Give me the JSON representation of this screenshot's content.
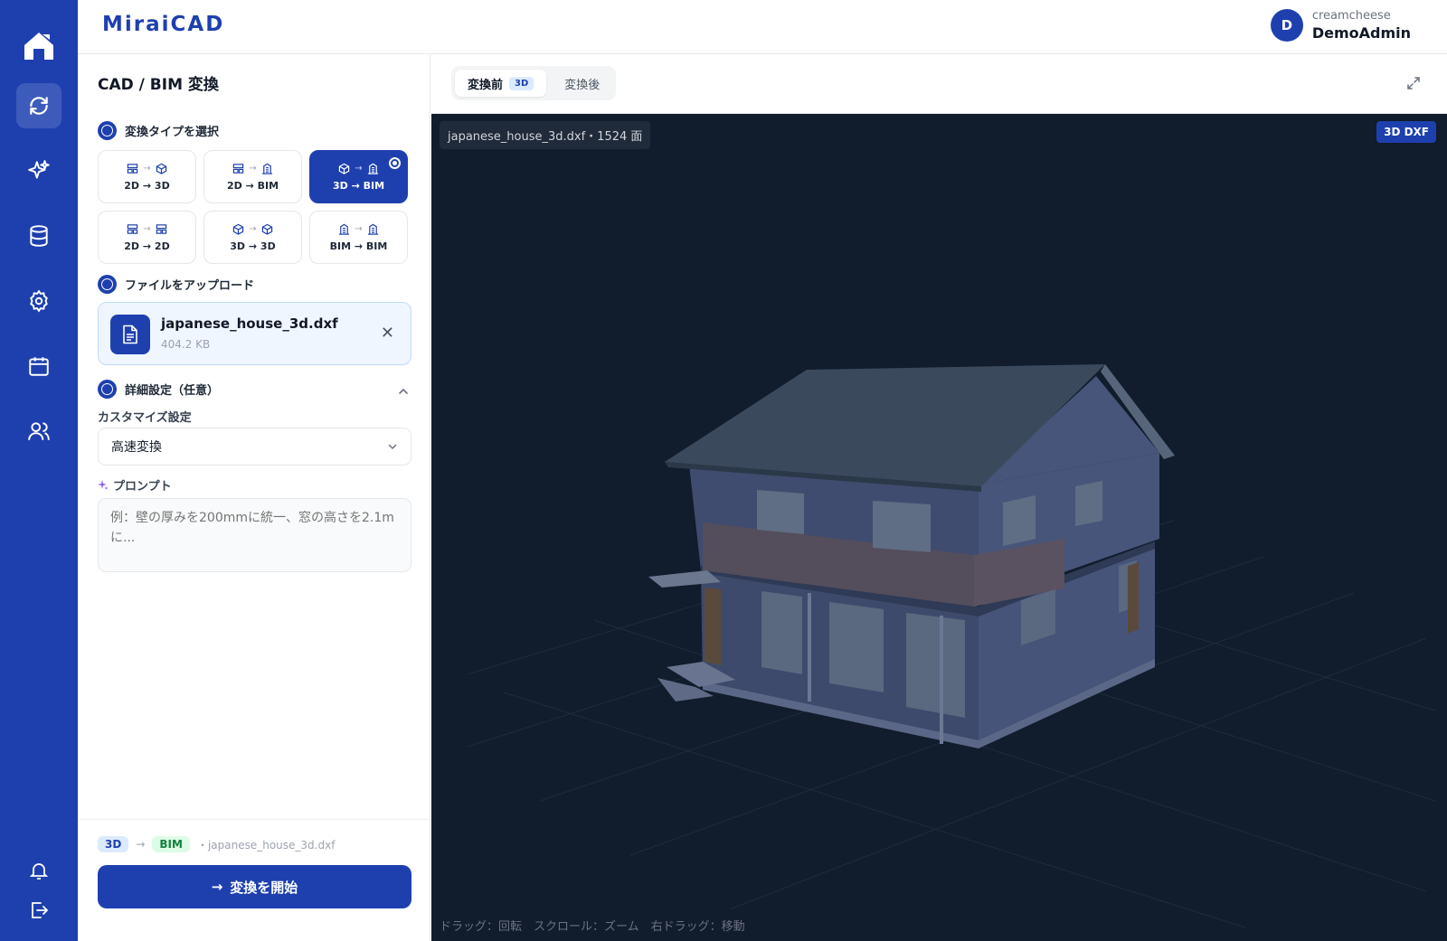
{
  "brand": "MiraiCAD",
  "user": {
    "avatar_letter": "D",
    "org": "creamcheese",
    "name": "DemoAdmin"
  },
  "sidebar": {
    "items": [
      {
        "name": "refresh-icon",
        "active": true
      },
      {
        "name": "sparkle-icon"
      },
      {
        "name": "database-icon"
      },
      {
        "name": "gear-icon"
      },
      {
        "name": "calendar-icon"
      },
      {
        "name": "users-icon"
      }
    ],
    "bottom": [
      "bell-icon",
      "logout-icon"
    ]
  },
  "panel": {
    "title": "CAD / BIM 変換",
    "step1": "変換タイプを選択",
    "types": [
      {
        "label": "2D → 3D",
        "from": "2d",
        "to": "3d"
      },
      {
        "label": "2D → BIM",
        "from": "2d",
        "to": "bim"
      },
      {
        "label": "3D → BIM",
        "from": "3d",
        "to": "bim",
        "selected": true
      },
      {
        "label": "2D → 2D",
        "from": "2d",
        "to": "2d"
      },
      {
        "label": "3D → 3D",
        "from": "3d",
        "to": "3d"
      },
      {
        "label": "BIM → BIM",
        "from": "bim",
        "to": "bim"
      }
    ],
    "step2": "ファイルをアップロード",
    "file": {
      "name": "japanese_house_3d.dxf",
      "size": "404.2 KB"
    },
    "step3": "詳細設定（任意）",
    "customize_label": "カスタマイズ設定",
    "customize_value": "高速変換",
    "prompt_label": "プロンプト",
    "prompt_placeholder": "例：壁の厚みを200mmに統一、窓の高さを2.1mに...",
    "route": {
      "from": "3D",
      "to": "BIM",
      "file": "・japanese_house_3d.dxf"
    },
    "start_label": "変換を開始"
  },
  "viewer": {
    "tabs": [
      {
        "label": "変換前",
        "badge": "3D",
        "active": true
      },
      {
        "label": "変換後"
      }
    ],
    "file_info": "japanese_house_3d.dxf・1524 面",
    "format_badge": "3D DXF",
    "hint": "ドラッグ：回転　スクロール：ズーム　右ドラッグ：移動"
  }
}
